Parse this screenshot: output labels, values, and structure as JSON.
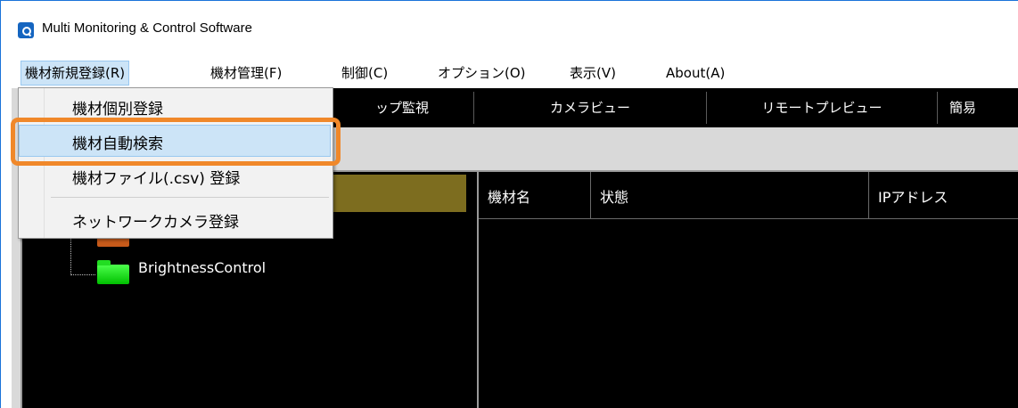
{
  "window": {
    "title": "Multi Monitoring & Control Software",
    "icon": "app-logo-icon"
  },
  "menubar": {
    "items": [
      {
        "label": "機材新規登録(R)",
        "active": true
      },
      {
        "label": "機材管理(F)"
      },
      {
        "label": "制御(C)"
      },
      {
        "label": "オプション(O)"
      },
      {
        "label": "表示(V)"
      },
      {
        "label": "About(A)"
      }
    ]
  },
  "dropdown": {
    "items": [
      {
        "label": "機材個別登録"
      },
      {
        "label": "機材自動検索",
        "highlighted": true
      },
      {
        "label": "機材ファイル(.csv) 登録"
      },
      {
        "label": "ネットワークカメラ登録"
      }
    ]
  },
  "tabs": [
    {
      "label": "ップ監視"
    },
    {
      "label": "カメラビュー"
    },
    {
      "label": "リモートプレビュー"
    },
    {
      "label": "簡易"
    }
  ],
  "tree": {
    "node_label": "BrightnessControl"
  },
  "grid": {
    "columns": [
      "機材名",
      "状態",
      "IPアドレス"
    ]
  },
  "colors": {
    "callout": "#f0882a",
    "highlight": "#cce4f7",
    "panel_bg": "#000000",
    "folder": "#22dd22",
    "tree_selected": "#7d6d1f"
  }
}
